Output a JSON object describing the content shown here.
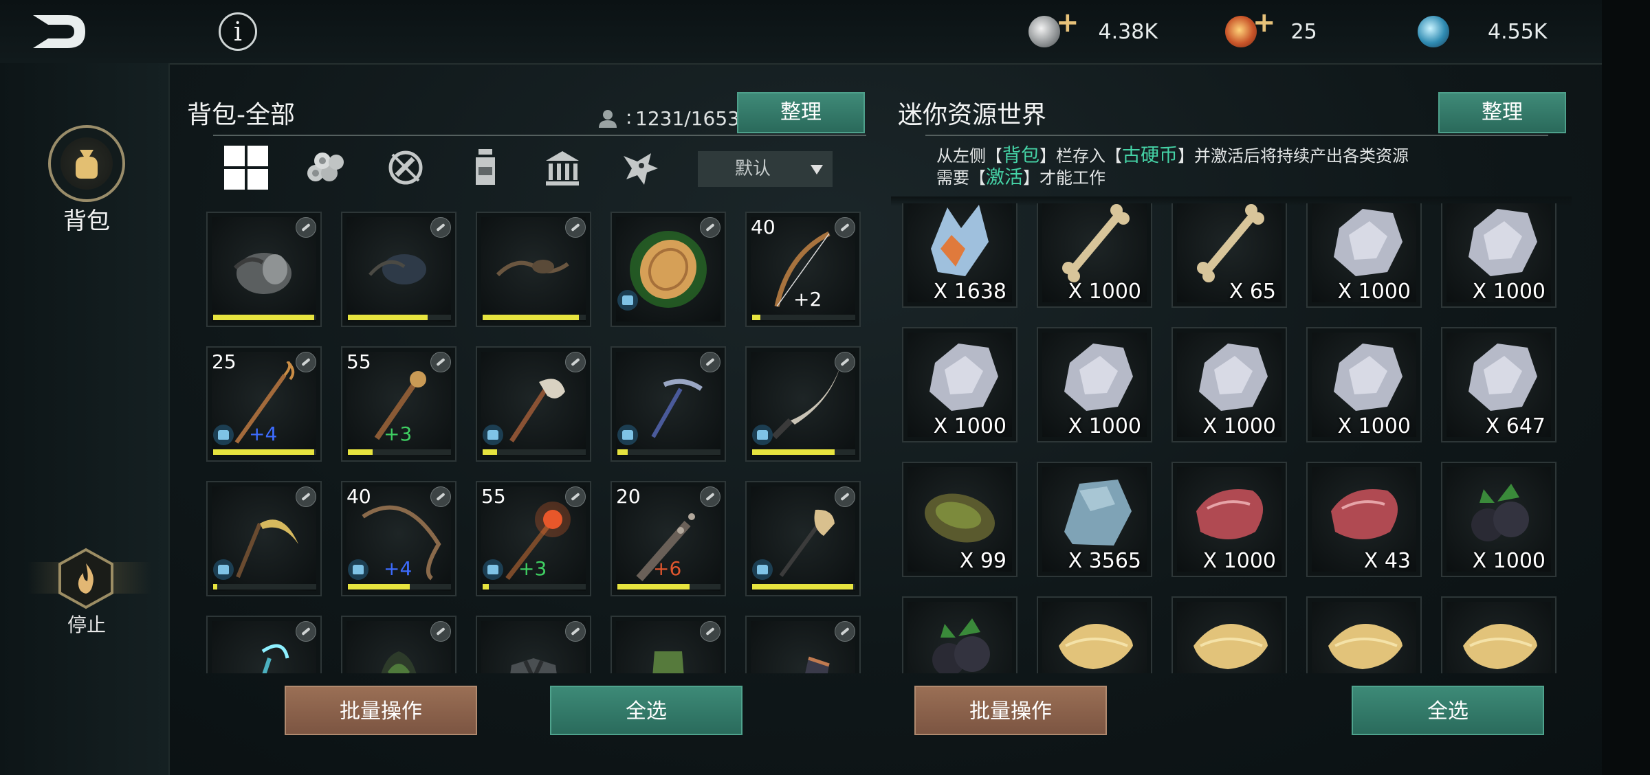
{
  "currencies": [
    {
      "name": "silver-coin-icon",
      "has_plus": true,
      "value": "4.38K"
    },
    {
      "name": "gold-coin-icon",
      "has_plus": true,
      "value": "25"
    },
    {
      "name": "globe-gem-icon",
      "has_plus": false,
      "value": "4.55K"
    }
  ],
  "nav": {
    "bag_label": "背包",
    "stop_label": "停止"
  },
  "backpack": {
    "title": "背包-全部",
    "capacity": "1231/1653",
    "sort_label": "整理",
    "dropdown_value": "默认",
    "tabs": [
      "grid-all-icon",
      "logs-icon",
      "no-weapon-icon",
      "potion-icon",
      "building-icon",
      "creature-icon"
    ],
    "items": [
      {
        "art": "chest-armor",
        "level": "",
        "bonus": "",
        "bonus_color": "",
        "bar": 0.98,
        "shirt": false
      },
      {
        "art": "leather-armor",
        "level": "",
        "bonus": "",
        "bonus_color": "",
        "bar": 0.77,
        "shirt": false
      },
      {
        "art": "sling-armor",
        "level": "",
        "bonus": "",
        "bonus_color": "",
        "bar": 0.93,
        "shirt": false
      },
      {
        "art": "green-coin",
        "level": "",
        "bonus": "",
        "bonus_color": "",
        "bar": 0,
        "shirt": true
      },
      {
        "art": "bow",
        "level": "40",
        "bonus": "+2",
        "bonus_color": "#ffffff",
        "bar": 0.08,
        "shirt": false
      },
      {
        "art": "staff",
        "level": "25",
        "bonus": "+4",
        "bonus_color": "#3d6cff",
        "bar": 0.98,
        "shirt": true
      },
      {
        "art": "scepter",
        "level": "55",
        "bonus": "+3",
        "bonus_color": "#3fcf62",
        "bar": 0.24,
        "shirt": false
      },
      {
        "art": "axe",
        "level": "",
        "bonus": "",
        "bonus_color": "",
        "bar": 0.14,
        "shirt": true
      },
      {
        "art": "pickaxe",
        "level": "",
        "bonus": "",
        "bonus_color": "",
        "bar": 0.1,
        "shirt": true
      },
      {
        "art": "knife",
        "level": "",
        "bonus": "",
        "bonus_color": "",
        "bar": 0.8,
        "shirt": true
      },
      {
        "art": "sickle",
        "level": "",
        "bonus": "",
        "bonus_color": "",
        "bar": 0.04,
        "shirt": true
      },
      {
        "art": "longbow",
        "level": "40",
        "bonus": "+4",
        "bonus_color": "#3d6cff",
        "bar": 0.6,
        "shirt": true
      },
      {
        "art": "fire-staff",
        "level": "55",
        "bonus": "+3",
        "bonus_color": "#3fcf62",
        "bar": 0.06,
        "shirt": true
      },
      {
        "art": "spiked-club",
        "level": "20",
        "bonus": "+6",
        "bonus_color": "#e0562e",
        "bar": 0.7,
        "shirt": false
      },
      {
        "art": "shovel",
        "level": "",
        "bonus": "",
        "bonus_color": "",
        "bar": 0.98,
        "shirt": true
      },
      {
        "art": "crystal-staff",
        "level": "",
        "bonus": "",
        "bonus_color": "",
        "bar": 0,
        "shirt": false
      },
      {
        "art": "green-hood",
        "level": "",
        "bonus": "",
        "bonus_color": "",
        "bar": 0,
        "shirt": false
      },
      {
        "art": "gray-tunic",
        "level": "",
        "bonus": "",
        "bonus_color": "",
        "bar": 0,
        "shirt": false
      },
      {
        "art": "green-pants",
        "level": "",
        "bonus": "",
        "bonus_color": "",
        "bar": 0,
        "shirt": false
      },
      {
        "art": "bracer",
        "level": "",
        "bonus": "",
        "bonus_color": "",
        "bar": 0,
        "shirt": false
      }
    ],
    "batch_label": "批量操作",
    "select_all_label": "全选"
  },
  "resources": {
    "title": "迷你资源世界",
    "sort_label": "整理",
    "note": {
      "l1_a": "从左侧【",
      "l1_b": "背包",
      "l1_c": "】栏存入【",
      "l1_d": "古硬币",
      "l1_e": "】并激活后将持续产出各类资源",
      "l2_a": "需要【",
      "l2_b": "激活",
      "l2_c": "】才能工作"
    },
    "items": [
      {
        "art": "crystal",
        "qty": "X 1638"
      },
      {
        "art": "bone",
        "qty": "X 1000"
      },
      {
        "art": "bone",
        "qty": "X 65"
      },
      {
        "art": "iron-ore",
        "qty": "X 1000"
      },
      {
        "art": "iron-ore",
        "qty": "X 1000"
      },
      {
        "art": "iron-ore",
        "qty": "X 1000"
      },
      {
        "art": "iron-ore",
        "qty": "X 1000"
      },
      {
        "art": "iron-ore",
        "qty": "X 1000"
      },
      {
        "art": "iron-ore",
        "qty": "X 1000"
      },
      {
        "art": "iron-ore",
        "qty": "X 647"
      },
      {
        "art": "mossy-wood",
        "qty": "X 99"
      },
      {
        "art": "stone",
        "qty": "X 3565"
      },
      {
        "art": "raw-meat",
        "qty": "X 1000"
      },
      {
        "art": "raw-meat",
        "qty": "X 43"
      },
      {
        "art": "blackberry",
        "qty": "X 1000"
      },
      {
        "art": "blackberry",
        "qty": ""
      },
      {
        "art": "fiber",
        "qty": ""
      },
      {
        "art": "fiber",
        "qty": ""
      },
      {
        "art": "fiber",
        "qty": ""
      },
      {
        "art": "fiber",
        "qty": ""
      }
    ],
    "batch_label": "批量操作",
    "select_all_label": "全选"
  }
}
